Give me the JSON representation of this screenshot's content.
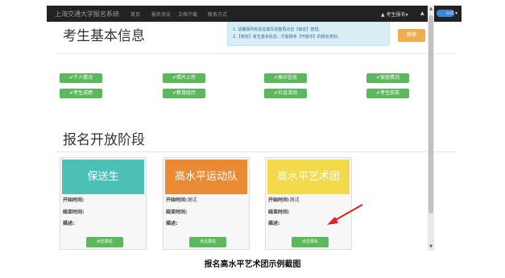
{
  "navbar": {
    "brand": "上海交通大学报名系统",
    "links": [
      "首页",
      "报名协议",
      "文档下载",
      "联系方式"
    ],
    "exam_menu": "▲ 考生报名▾",
    "user_menu": "est ▾"
  },
  "profile": {
    "title": "考生基本信息",
    "notice_lines": [
      "1. 请确保所有信息填写完整再点击【锁定】按钮。",
      "2.【锁定】考生基本信息，才能报考【开放中】的报名类别。"
    ],
    "unlock_label": "解锁",
    "buttons": [
      "✔个人情况",
      "✔照片上传",
      "✔高中信息",
      "✔家庭情况",
      "✔考生成绩",
      "✔教育经历",
      "✔社会活动",
      "✔考生获奖"
    ]
  },
  "stage": {
    "title": "报名开放阶段",
    "start_label": "开始时间:",
    "end_label": "结束时间:",
    "desc_label": "描述:",
    "apply_label": "点击报名",
    "cards": [
      {
        "name": "保送生",
        "color": "#4dc0b5",
        "start_value": ""
      },
      {
        "name": "高水平运动队",
        "color": "#ea8a35",
        "start_value": "测试"
      },
      {
        "name": "高水平艺术团",
        "color": "#f2da4a",
        "start_value": "测试"
      }
    ]
  },
  "caption": "报名高水平艺术团示例截图",
  "colors": {
    "arrow": "#e02020",
    "navbar": "#222222",
    "success": "#5cb85c",
    "warning": "#f0ad4e"
  }
}
